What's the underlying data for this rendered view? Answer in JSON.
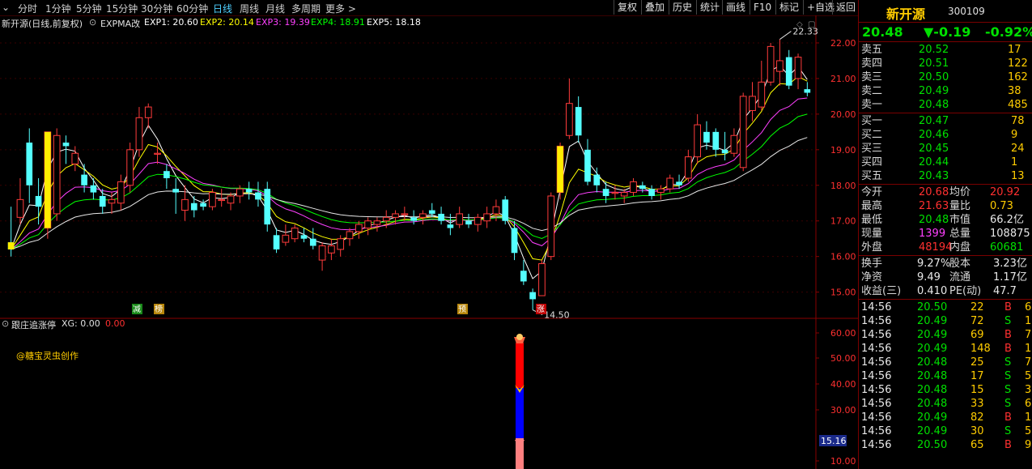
{
  "toolbar": {
    "timeframes": [
      "分时",
      "1分钟",
      "5分钟",
      "15分钟",
      "30分钟",
      "60分钟",
      "日线",
      "周线",
      "月线",
      "多周期",
      "更多 >"
    ],
    "active": "日线",
    "buttons": [
      "复权",
      "叠加",
      "历史",
      "统计",
      "画线",
      "F10",
      "标记",
      "+自选",
      "返回"
    ]
  },
  "main_chart": {
    "title": "新开源(日线,前复权)",
    "indicator_name": "EXPMA改",
    "exp": [
      {
        "label": "EXP1: 20.60",
        "color": "#ffffff"
      },
      {
        "label": "EXP2: 20.14",
        "color": "#ffff00"
      },
      {
        "label": "EXP3: 19.39",
        "color": "#ff40ff"
      },
      {
        "label": "EXP4: 18.91",
        "color": "#00ff00"
      },
      {
        "label": "EXP5: 18.18",
        "color": "#ffffff"
      }
    ],
    "high_marker": "22.33",
    "low_marker": "14.50",
    "y_ticks": [
      "22.00",
      "21.00",
      "20.00",
      "19.00",
      "18.00",
      "17.00",
      "16.00",
      "15.00"
    ],
    "signals": [
      "减",
      "榜",
      "预",
      "涨"
    ]
  },
  "sub_chart": {
    "title": "跟庄追涨停",
    "xg": "XG: 0.00",
    "val2": "0.00",
    "credit": "@糖宝灵虫创作",
    "y_ticks": [
      "60.00",
      "50.00",
      "40.00",
      "30.00",
      "10.00"
    ],
    "cursor_value": "15.16"
  },
  "chart_data": {
    "type": "candlestick",
    "ylim": [
      14.4,
      22.5
    ],
    "candles": [
      [
        16.4,
        17.4,
        16.0,
        16.2
      ],
      [
        17.1,
        18.2,
        16.9,
        17.6
      ],
      [
        19.2,
        19.6,
        17.5,
        18.0
      ],
      [
        17.7,
        18.2,
        16.9,
        17.4
      ],
      [
        16.8,
        17.5,
        16.5,
        19.5
      ],
      [
        17.2,
        19.6,
        17.0,
        19.4
      ],
      [
        19.2,
        19.4,
        18.6,
        19.1
      ],
      [
        18.6,
        19.1,
        18.4,
        18.9
      ],
      [
        18.3,
        18.6,
        17.8,
        18.0
      ],
      [
        18.0,
        18.2,
        17.6,
        17.8
      ],
      [
        17.7,
        17.9,
        17.2,
        17.4
      ],
      [
        17.5,
        17.8,
        17.2,
        17.6
      ],
      [
        17.5,
        18.3,
        17.3,
        18.1
      ],
      [
        18.0,
        19.2,
        17.8,
        19.0
      ],
      [
        19.0,
        20.2,
        18.8,
        19.9
      ],
      [
        19.9,
        20.3,
        19.6,
        20.2
      ],
      [
        18.9,
        19.2,
        18.6,
        18.9
      ],
      [
        18.4,
        18.6,
        17.9,
        18.2
      ],
      [
        17.9,
        18.2,
        17.2,
        17.8
      ],
      [
        17.3,
        18.0,
        17.0,
        17.6
      ],
      [
        17.5,
        17.7,
        17.1,
        17.3
      ],
      [
        17.5,
        17.6,
        17.3,
        17.4
      ],
      [
        17.4,
        17.9,
        17.3,
        17.8
      ],
      [
        17.6,
        17.9,
        17.4,
        17.6
      ],
      [
        17.5,
        17.8,
        17.3,
        17.7
      ],
      [
        17.7,
        18.0,
        17.5,
        17.9
      ],
      [
        17.9,
        18.1,
        17.6,
        17.8
      ],
      [
        17.8,
        18.1,
        17.4,
        17.6
      ],
      [
        17.9,
        18.1,
        16.7,
        16.9
      ],
      [
        16.6,
        16.8,
        16.1,
        16.2
      ],
      [
        16.4,
        16.9,
        16.3,
        16.6
      ],
      [
        16.5,
        16.9,
        16.4,
        16.8
      ],
      [
        16.6,
        16.8,
        16.4,
        16.5
      ],
      [
        16.5,
        16.8,
        16.2,
        16.3
      ],
      [
        15.9,
        16.4,
        15.6,
        16.3
      ],
      [
        16.1,
        16.5,
        15.9,
        16.3
      ],
      [
        16.2,
        16.6,
        16.0,
        16.5
      ],
      [
        16.5,
        16.8,
        16.3,
        16.7
      ],
      [
        16.7,
        17.0,
        16.5,
        16.9
      ],
      [
        16.8,
        17.1,
        16.6,
        17.0
      ],
      [
        16.9,
        17.1,
        16.7,
        17.0
      ],
      [
        17.0,
        17.3,
        16.8,
        17.1
      ],
      [
        17.1,
        17.3,
        16.9,
        17.2
      ],
      [
        17.2,
        17.4,
        17.0,
        17.2
      ],
      [
        17.1,
        17.3,
        16.9,
        17.0
      ],
      [
        17.1,
        17.3,
        16.9,
        17.2
      ],
      [
        17.3,
        17.5,
        17.1,
        17.2
      ],
      [
        17.2,
        17.4,
        16.9,
        17.0
      ],
      [
        16.9,
        17.2,
        16.6,
        16.8
      ],
      [
        16.9,
        17.4,
        16.8,
        17.2
      ],
      [
        17.0,
        17.2,
        16.8,
        16.9
      ],
      [
        16.9,
        17.2,
        16.7,
        17.1
      ],
      [
        17.0,
        17.4,
        16.8,
        17.2
      ],
      [
        17.2,
        17.6,
        17.0,
        17.4
      ],
      [
        17.6,
        17.7,
        16.9,
        17.0
      ],
      [
        16.8,
        17.0,
        15.9,
        16.1
      ],
      [
        15.6,
        15.9,
        15.2,
        15.3
      ],
      [
        15.0,
        15.1,
        14.5,
        14.8
      ],
      [
        14.9,
        15.9,
        14.9,
        15.8
      ],
      [
        16.0,
        17.8,
        15.9,
        17.7
      ],
      [
        17.8,
        19.2,
        17.6,
        19.1
      ],
      [
        19.4,
        21.0,
        19.3,
        20.3
      ],
      [
        20.2,
        20.5,
        19.2,
        19.4
      ],
      [
        19.0,
        19.3,
        18.0,
        18.1
      ],
      [
        18.3,
        18.5,
        17.8,
        18.0
      ],
      [
        17.9,
        18.1,
        17.5,
        17.7
      ],
      [
        17.8,
        18.0,
        17.6,
        17.8
      ],
      [
        17.7,
        17.9,
        17.5,
        17.8
      ],
      [
        17.8,
        18.2,
        17.7,
        18.1
      ],
      [
        18.0,
        18.1,
        17.8,
        17.9
      ],
      [
        17.9,
        18.0,
        17.6,
        17.7
      ],
      [
        17.8,
        18.0,
        17.6,
        17.9
      ],
      [
        17.9,
        18.3,
        17.8,
        18.2
      ],
      [
        18.1,
        18.3,
        17.9,
        18.0
      ],
      [
        18.2,
        19.0,
        18.1,
        18.8
      ],
      [
        18.8,
        20.0,
        18.6,
        19.7
      ],
      [
        19.5,
        19.8,
        19.0,
        19.2
      ],
      [
        19.5,
        19.6,
        18.8,
        19.0
      ],
      [
        19.0,
        19.5,
        18.7,
        18.9
      ],
      [
        18.9,
        19.6,
        18.8,
        19.4
      ],
      [
        18.5,
        20.6,
        18.4,
        20.5
      ],
      [
        20.1,
        20.9,
        19.8,
        20.5
      ],
      [
        20.2,
        21.5,
        20.1,
        20.9
      ],
      [
        20.9,
        22.0,
        20.8,
        21.9
      ],
      [
        21.2,
        22.1,
        20.8,
        21.5
      ],
      [
        21.6,
        21.8,
        20.7,
        20.8
      ],
      [
        21.0,
        21.7,
        20.7,
        21.6
      ],
      [
        20.7,
        20.9,
        20.5,
        20.6
      ]
    ]
  },
  "panel": {
    "name": "新开源",
    "code": "300109",
    "price": "20.48",
    "change": "▼-0.19",
    "pct": "-0.92%",
    "sells": [
      {
        "label": "卖五",
        "price": "20.52",
        "vol": "17"
      },
      {
        "label": "卖四",
        "price": "20.51",
        "vol": "122"
      },
      {
        "label": "卖三",
        "price": "20.50",
        "vol": "162"
      },
      {
        "label": "卖二",
        "price": "20.49",
        "vol": "38"
      },
      {
        "label": "卖一",
        "price": "20.48",
        "vol": "485"
      }
    ],
    "buys": [
      {
        "label": "买一",
        "price": "20.47",
        "vol": "78"
      },
      {
        "label": "买二",
        "price": "20.46",
        "vol": "9"
      },
      {
        "label": "买三",
        "price": "20.45",
        "vol": "24"
      },
      {
        "label": "买四",
        "price": "20.44",
        "vol": "1"
      },
      {
        "label": "买五",
        "price": "20.43",
        "vol": "13"
      }
    ],
    "stats": [
      {
        "l1": "今开",
        "v1": "20.68",
        "c1": "red",
        "l2": "均价",
        "v2": "20.92",
        "c2": "red"
      },
      {
        "l1": "最高",
        "v1": "21.63",
        "c1": "red",
        "l2": "量比",
        "v2": "0.73",
        "c2": "yel"
      },
      {
        "l1": "最低",
        "v1": "20.48",
        "c1": "grn",
        "l2": "市值",
        "v2": "66.2亿",
        "c2": "wht"
      },
      {
        "l1": "现量",
        "v1": "1399",
        "c1": "mag",
        "l2": "总量",
        "v2": "108875",
        "c2": "wht"
      },
      {
        "l1": "外盘",
        "v1": "48194",
        "c1": "red",
        "l2": "内盘",
        "v2": "60681",
        "c2": "grn"
      }
    ],
    "stats2": [
      {
        "l1": "换手",
        "v1": "9.27%",
        "l2": "股本",
        "v2": "3.23亿"
      },
      {
        "l1": "净资",
        "v1": "9.49",
        "l2": "流通",
        "v2": "1.17亿"
      },
      {
        "l1": "收益(三)",
        "v1": "0.410",
        "l2": "PE(动)",
        "v2": "47.7"
      }
    ],
    "ticks": [
      {
        "t": "14:56",
        "p": "20.50",
        "pc": "grn",
        "v": "22",
        "d": "B",
        "x": "6"
      },
      {
        "t": "14:56",
        "p": "20.49",
        "pc": "grn",
        "v": "72",
        "d": "S",
        "x": "12"
      },
      {
        "t": "14:56",
        "p": "20.49",
        "pc": "grn",
        "v": "69",
        "d": "B",
        "x": "7"
      },
      {
        "t": "14:56",
        "p": "20.49",
        "pc": "grn",
        "v": "148",
        "d": "B",
        "x": "10"
      },
      {
        "t": "14:56",
        "p": "20.48",
        "pc": "grn",
        "v": "25",
        "d": "S",
        "x": "7"
      },
      {
        "t": "14:56",
        "p": "20.48",
        "pc": "grn",
        "v": "17",
        "d": "S",
        "x": "5"
      },
      {
        "t": "14:56",
        "p": "20.48",
        "pc": "grn",
        "v": "15",
        "d": "S",
        "x": "3"
      },
      {
        "t": "14:56",
        "p": "20.48",
        "pc": "grn",
        "v": "33",
        "d": "S",
        "x": "6"
      },
      {
        "t": "14:56",
        "p": "20.49",
        "pc": "grn",
        "v": "82",
        "d": "B",
        "x": "11"
      },
      {
        "t": "14:56",
        "p": "20.49",
        "pc": "grn",
        "v": "30",
        "d": "S",
        "x": "5"
      },
      {
        "t": "14:56",
        "p": "20.50",
        "pc": "grn",
        "v": "65",
        "d": "B",
        "x": "9"
      }
    ]
  }
}
